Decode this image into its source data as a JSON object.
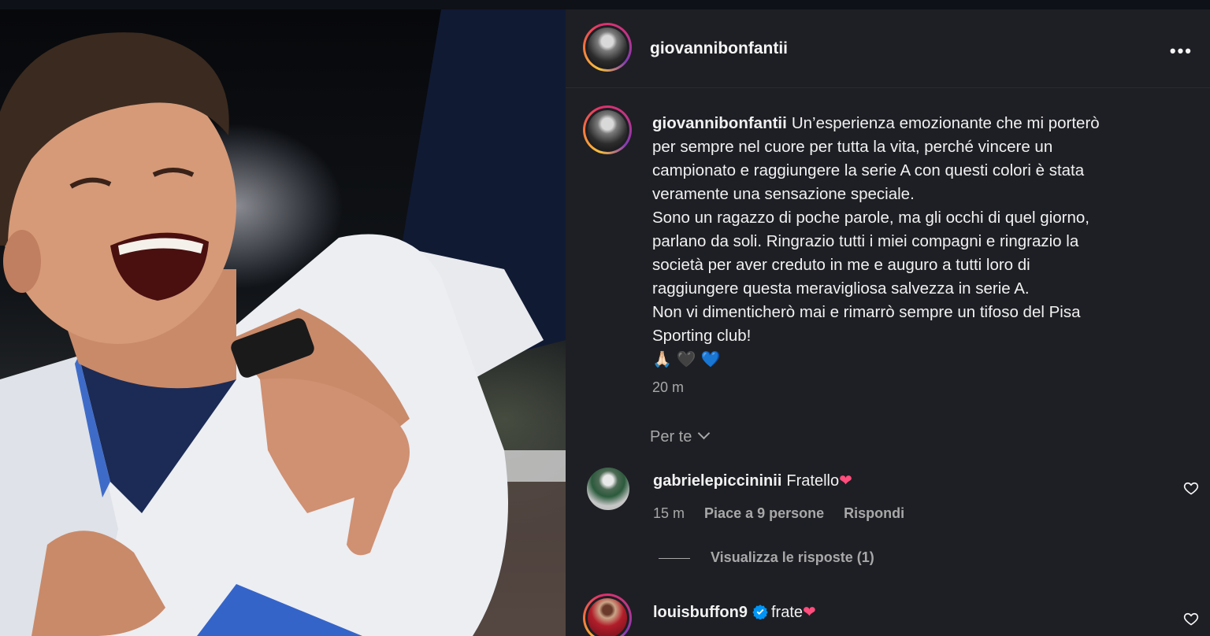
{
  "post": {
    "author": "giovannibonfantii",
    "more_icon": "more-icon",
    "caption_lines": [
      "Un’esperienza emozionante che mi porterò",
      "per sempre nel cuore per tutta la vita, perché vincere un",
      "campionato e raggiungere la serie A con questi colori è stata",
      "veramente una sensazione speciale.",
      "Sono un ragazzo di poche parole, ma gli occhi di quel giorno,",
      "parlano da soli. Ringrazio tutti i miei compagni e ringrazio la",
      "società per aver creduto in me e auguro a tutti loro di",
      "raggiungere questa meravigliosa salvezza in serie A.",
      "Non vi dimenticherò mai e rimarrò sempre un tifoso del Pisa",
      "Sporting club!"
    ],
    "emojis": "🙏🏻🖤💙",
    "time": "20 m"
  },
  "feed_filter": {
    "label": "Per te"
  },
  "comments": [
    {
      "username": "gabrielepiccininii",
      "text": "Fratello",
      "emoji": "❤",
      "time": "15 m",
      "likes": "Piace a 9 persone",
      "reply": "Rispondi",
      "view_replies": "Visualizza le risposte (1)"
    },
    {
      "username": "louisbuffon9",
      "verified": true,
      "text": "frate",
      "emoji": "❤"
    }
  ],
  "colors": {
    "panel_bg": "#1e1f24",
    "muted": "#a8a8a8",
    "verified": "#0095f6",
    "heart": "#ff4d7d"
  }
}
